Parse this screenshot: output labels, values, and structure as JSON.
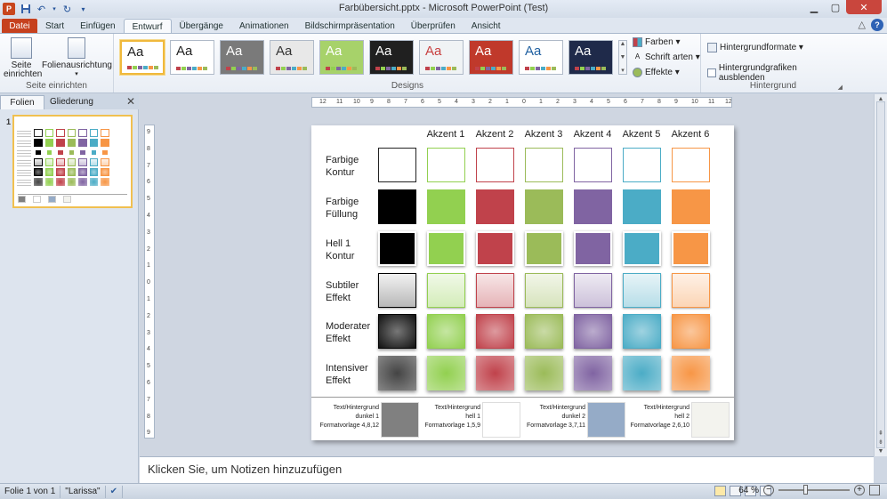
{
  "window": {
    "title": "Farbübersicht.pptx  -  Microsoft PowerPoint (Test)",
    "app_icon": "P",
    "qat_icons": [
      "save-icon",
      "undo-icon",
      "redo-icon",
      "customize-icon"
    ]
  },
  "tabs": [
    {
      "label": "Datei",
      "kind": "file"
    },
    {
      "label": "Start",
      "kind": "normal"
    },
    {
      "label": "Einfügen",
      "kind": "normal"
    },
    {
      "label": "Entwurf",
      "kind": "active"
    },
    {
      "label": "Übergänge",
      "kind": "normal"
    },
    {
      "label": "Animationen",
      "kind": "normal"
    },
    {
      "label": "Bildschirmpräsentation",
      "kind": "normal"
    },
    {
      "label": "Überprüfen",
      "kind": "normal"
    },
    {
      "label": "Ansicht",
      "kind": "normal"
    }
  ],
  "ribbon": {
    "seite_einrichten": {
      "label": "Seite einrichten",
      "btn1_line1": "Seite",
      "btn1_line2": "einrichten",
      "btn2_line1": "Folienausrichtung",
      "btn2_line2": "▾"
    },
    "designs": {
      "label": "Designs",
      "themes": [
        {
          "text": "Aa",
          "bg": "#ffffff",
          "fg": "#222222",
          "selected": true
        },
        {
          "text": "Aa",
          "bg": "#ffffff",
          "fg": "#222222"
        },
        {
          "text": "Aa",
          "bg": "#7a7a7a",
          "fg": "#ffffff"
        },
        {
          "text": "Aa",
          "bg": "#e8e8e8",
          "fg": "#333333"
        },
        {
          "text": "Aa",
          "bg": "#a7d26a",
          "fg": "#ffffff"
        },
        {
          "text": "Aa",
          "bg": "#202020",
          "fg": "#ffffff"
        },
        {
          "text": "Aa",
          "bg": "#f0f3f5",
          "fg": "#c84040"
        },
        {
          "text": "Aa",
          "bg": "#c0392b",
          "fg": "#ffffff"
        },
        {
          "text": "Aa",
          "bg": "#ffffff",
          "fg": "#1f5fa0"
        },
        {
          "text": "Aa",
          "bg": "#1f2a4a",
          "fg": "#ffffff"
        }
      ],
      "farben": "Farben ▾",
      "schriftarten": "Schrift arten ▾",
      "effekte": "Effekte ▾"
    },
    "hintergrund": {
      "label": "Hintergrund",
      "formate": "Hintergrundformate ▾",
      "ausblenden": "Hintergrundgrafiken ausblenden"
    }
  },
  "panel": {
    "tab_folien": "Folien",
    "tab_gliederung": "Gliederung",
    "close": "✕",
    "slide_number": "1"
  },
  "slide": {
    "columns": [
      "Akzent 1",
      "Akzent 2",
      "Akzent 3",
      "Akzent 4",
      "Akzent 5",
      "Akzent 6"
    ],
    "rows": [
      {
        "line1": "Farbige",
        "line2": "Kontur",
        "style": "outline"
      },
      {
        "line1": "Farbige",
        "line2": "Füllung",
        "style": "fill"
      },
      {
        "line1": "Hell 1",
        "line2": "Kontur",
        "style": "light-outline"
      },
      {
        "line1": "Subtiler",
        "line2": "Effekt",
        "style": "subtle"
      },
      {
        "line1": "Moderater",
        "line2": "Effekt",
        "style": "moderate"
      },
      {
        "line1": "Intensiver",
        "line2": "Effekt",
        "style": "intense"
      }
    ],
    "colors": [
      "#000000",
      "#92d050",
      "#c0424b",
      "#9bbb59",
      "#8064a2",
      "#4bacc6",
      "#f79646"
    ],
    "footer": [
      {
        "line1": "Text/Hintergrund",
        "line2": "dunkel 1",
        "line3": "Formatvorlage 4,8,12",
        "color": "#808080"
      },
      {
        "line1": "Text/Hintergrund",
        "line2": "hell 1",
        "line3": "Formatvorlage 1,5,9",
        "color": "#ffffff"
      },
      {
        "line1": "Text/Hintergrund",
        "line2": "dunkel 2",
        "line3": "Formatvorlage 3,7,11",
        "color": "#95abc7"
      },
      {
        "line1": "Text/Hintergrund",
        "line2": "hell 2",
        "line3": "Formatvorlage 2,6,10",
        "color": "#f3f3ee"
      }
    ]
  },
  "rulers": {
    "h": [
      "12",
      "11",
      "10",
      "9",
      "8",
      "7",
      "6",
      "5",
      "4",
      "3",
      "2",
      "1",
      "0",
      "1",
      "2",
      "3",
      "4",
      "5",
      "6",
      "7",
      "8",
      "9",
      "10",
      "11",
      "12"
    ],
    "v": [
      "9",
      "8",
      "7",
      "6",
      "5",
      "4",
      "3",
      "2",
      "1",
      "0",
      "1",
      "2",
      "3",
      "4",
      "5",
      "6",
      "7",
      "8",
      "9"
    ]
  },
  "notes_placeholder": "Klicken Sie, um Notizen hinzuzufügen",
  "status": {
    "slide": "Folie 1 von 1",
    "theme": "\"Larissa\"",
    "zoom": "64 %"
  }
}
